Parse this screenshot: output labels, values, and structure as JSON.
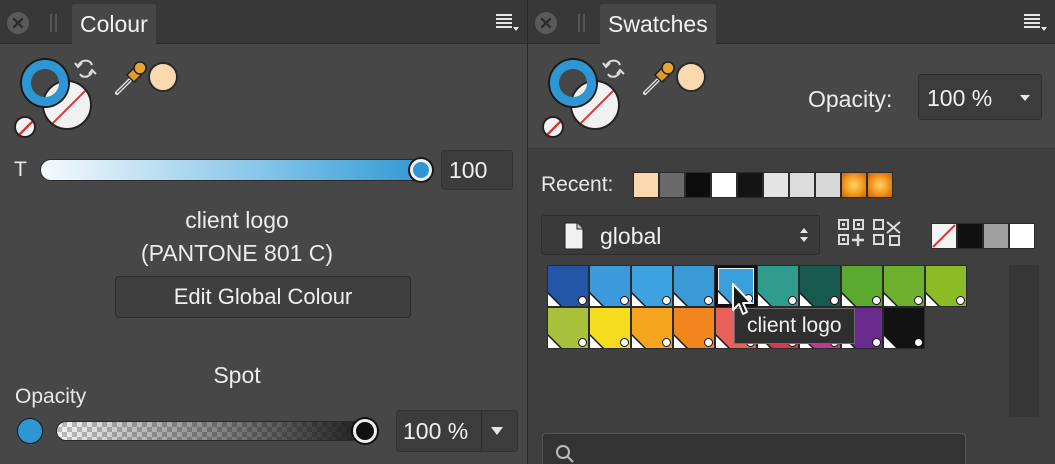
{
  "colour_panel": {
    "tab_title": "Colour",
    "transparency_label": "T",
    "transparency_value": "100",
    "colour_name": "client logo",
    "colour_code": "(PANTONE 801 C)",
    "edit_button": "Edit Global Colour",
    "colour_type": "Spot",
    "opacity_label": "Opacity",
    "opacity_value": "100 %"
  },
  "swatches_panel": {
    "tab_title": "Swatches",
    "opacity_label": "Opacity:",
    "opacity_value": "100 %",
    "recent_label": "Recent:",
    "palette_name": "global",
    "tooltip": "client logo"
  },
  "colors": {
    "accent_blue": "#2e97d3",
    "picked": "#fbd9b0",
    "panel_bg": "#474747"
  },
  "recent_swatches": [
    "#fbd9b0",
    "#6a6a6a",
    "#0d0d0d",
    "#ffffff",
    "#141414",
    "#e4e4e4",
    "#dcdcdc",
    "#d8d8d8",
    "#f39a1e",
    "#f3921a"
  ],
  "quick_swatches": [
    "none",
    "#111111",
    "#a0a0a0",
    "#ffffff"
  ],
  "palette_row1": [
    "#2356a6",
    "#3a9adb",
    "#3da2e0",
    "#3a9ad6",
    "#3aa0dc",
    "#2f9c8e",
    "#175a4e",
    "#5aaa2f",
    "#6cb02e",
    "#8bbb25"
  ],
  "palette_row2": [
    "#a9c03a",
    "#f5dc1f",
    "#f5a51e",
    "#f2861e",
    "#e8605a",
    "#d23a52",
    "#c23a90",
    "#6b2a8e",
    "#121212"
  ]
}
